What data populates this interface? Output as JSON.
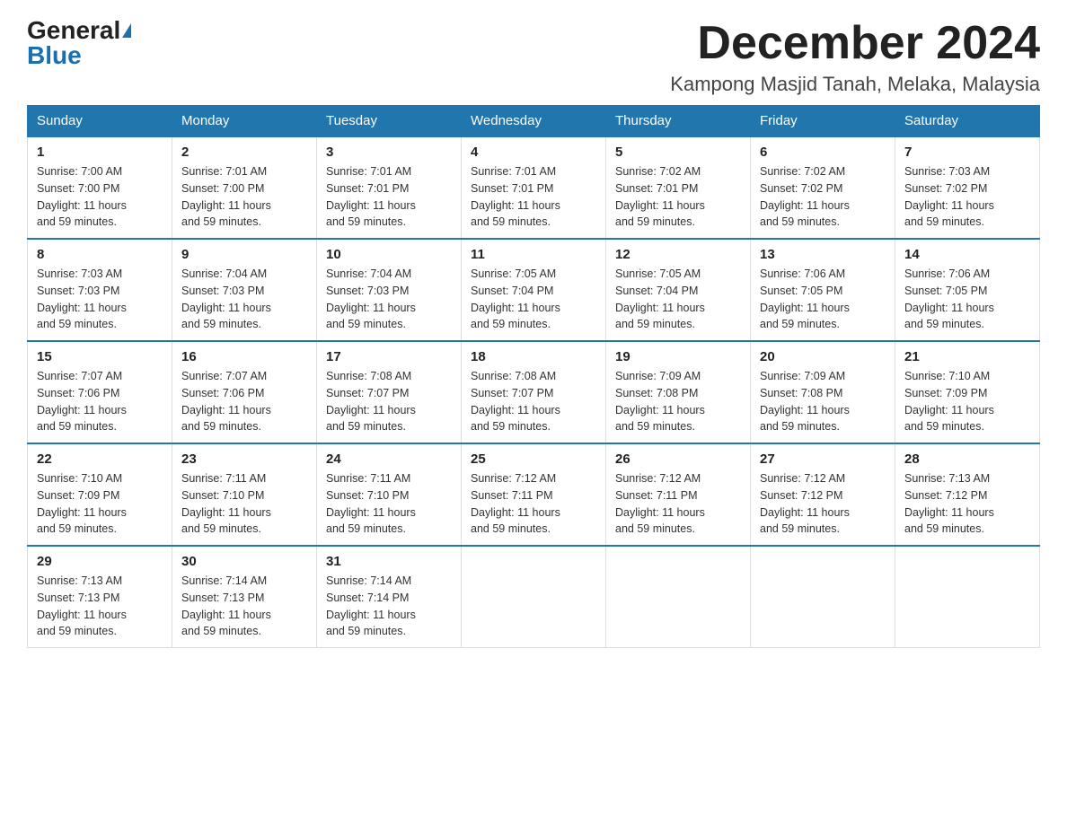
{
  "header": {
    "logo_general": "General",
    "logo_blue": "Blue",
    "month_title": "December 2024",
    "location": "Kampong Masjid Tanah, Melaka, Malaysia"
  },
  "days_of_week": [
    "Sunday",
    "Monday",
    "Tuesday",
    "Wednesday",
    "Thursday",
    "Friday",
    "Saturday"
  ],
  "weeks": [
    [
      {
        "day": "1",
        "sunrise": "7:00 AM",
        "sunset": "7:00 PM",
        "daylight": "11 hours and 59 minutes."
      },
      {
        "day": "2",
        "sunrise": "7:01 AM",
        "sunset": "7:00 PM",
        "daylight": "11 hours and 59 minutes."
      },
      {
        "day": "3",
        "sunrise": "7:01 AM",
        "sunset": "7:01 PM",
        "daylight": "11 hours and 59 minutes."
      },
      {
        "day": "4",
        "sunrise": "7:01 AM",
        "sunset": "7:01 PM",
        "daylight": "11 hours and 59 minutes."
      },
      {
        "day": "5",
        "sunrise": "7:02 AM",
        "sunset": "7:01 PM",
        "daylight": "11 hours and 59 minutes."
      },
      {
        "day": "6",
        "sunrise": "7:02 AM",
        "sunset": "7:02 PM",
        "daylight": "11 hours and 59 minutes."
      },
      {
        "day": "7",
        "sunrise": "7:03 AM",
        "sunset": "7:02 PM",
        "daylight": "11 hours and 59 minutes."
      }
    ],
    [
      {
        "day": "8",
        "sunrise": "7:03 AM",
        "sunset": "7:03 PM",
        "daylight": "11 hours and 59 minutes."
      },
      {
        "day": "9",
        "sunrise": "7:04 AM",
        "sunset": "7:03 PM",
        "daylight": "11 hours and 59 minutes."
      },
      {
        "day": "10",
        "sunrise": "7:04 AM",
        "sunset": "7:03 PM",
        "daylight": "11 hours and 59 minutes."
      },
      {
        "day": "11",
        "sunrise": "7:05 AM",
        "sunset": "7:04 PM",
        "daylight": "11 hours and 59 minutes."
      },
      {
        "day": "12",
        "sunrise": "7:05 AM",
        "sunset": "7:04 PM",
        "daylight": "11 hours and 59 minutes."
      },
      {
        "day": "13",
        "sunrise": "7:06 AM",
        "sunset": "7:05 PM",
        "daylight": "11 hours and 59 minutes."
      },
      {
        "day": "14",
        "sunrise": "7:06 AM",
        "sunset": "7:05 PM",
        "daylight": "11 hours and 59 minutes."
      }
    ],
    [
      {
        "day": "15",
        "sunrise": "7:07 AM",
        "sunset": "7:06 PM",
        "daylight": "11 hours and 59 minutes."
      },
      {
        "day": "16",
        "sunrise": "7:07 AM",
        "sunset": "7:06 PM",
        "daylight": "11 hours and 59 minutes."
      },
      {
        "day": "17",
        "sunrise": "7:08 AM",
        "sunset": "7:07 PM",
        "daylight": "11 hours and 59 minutes."
      },
      {
        "day": "18",
        "sunrise": "7:08 AM",
        "sunset": "7:07 PM",
        "daylight": "11 hours and 59 minutes."
      },
      {
        "day": "19",
        "sunrise": "7:09 AM",
        "sunset": "7:08 PM",
        "daylight": "11 hours and 59 minutes."
      },
      {
        "day": "20",
        "sunrise": "7:09 AM",
        "sunset": "7:08 PM",
        "daylight": "11 hours and 59 minutes."
      },
      {
        "day": "21",
        "sunrise": "7:10 AM",
        "sunset": "7:09 PM",
        "daylight": "11 hours and 59 minutes."
      }
    ],
    [
      {
        "day": "22",
        "sunrise": "7:10 AM",
        "sunset": "7:09 PM",
        "daylight": "11 hours and 59 minutes."
      },
      {
        "day": "23",
        "sunrise": "7:11 AM",
        "sunset": "7:10 PM",
        "daylight": "11 hours and 59 minutes."
      },
      {
        "day": "24",
        "sunrise": "7:11 AM",
        "sunset": "7:10 PM",
        "daylight": "11 hours and 59 minutes."
      },
      {
        "day": "25",
        "sunrise": "7:12 AM",
        "sunset": "7:11 PM",
        "daylight": "11 hours and 59 minutes."
      },
      {
        "day": "26",
        "sunrise": "7:12 AM",
        "sunset": "7:11 PM",
        "daylight": "11 hours and 59 minutes."
      },
      {
        "day": "27",
        "sunrise": "7:12 AM",
        "sunset": "7:12 PM",
        "daylight": "11 hours and 59 minutes."
      },
      {
        "day": "28",
        "sunrise": "7:13 AM",
        "sunset": "7:12 PM",
        "daylight": "11 hours and 59 minutes."
      }
    ],
    [
      {
        "day": "29",
        "sunrise": "7:13 AM",
        "sunset": "7:13 PM",
        "daylight": "11 hours and 59 minutes."
      },
      {
        "day": "30",
        "sunrise": "7:14 AM",
        "sunset": "7:13 PM",
        "daylight": "11 hours and 59 minutes."
      },
      {
        "day": "31",
        "sunrise": "7:14 AM",
        "sunset": "7:14 PM",
        "daylight": "11 hours and 59 minutes."
      },
      null,
      null,
      null,
      null
    ]
  ],
  "labels": {
    "sunrise": "Sunrise: ",
    "sunset": "Sunset: ",
    "daylight": "Daylight: "
  }
}
